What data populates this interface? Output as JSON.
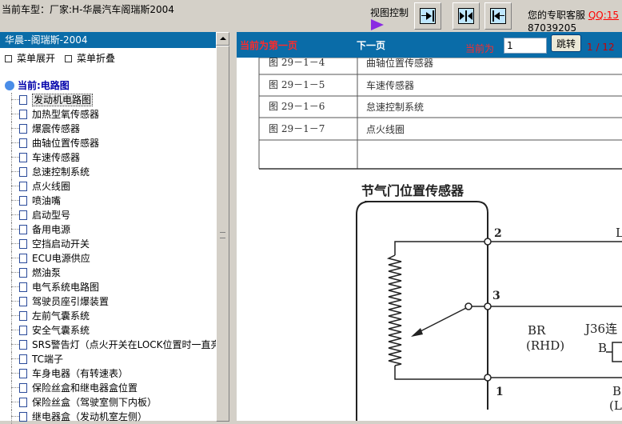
{
  "header": {
    "title": "当前车型：厂家:H-华晨汽车阁瑞斯2004",
    "view_control_label": "视图控制",
    "service_label": "您的专职客服",
    "qq_label": "QQ:15",
    "phone": "87039205"
  },
  "left_panel": {
    "title": "华晨--阁瑞斯-2004",
    "expand_all": "菜单展开",
    "collapse_all": "菜单折叠",
    "root_label": "当前:电路图",
    "items": [
      "发动机电路图",
      "加热型氧传感器",
      "爆震传感器",
      "曲轴位置传感器",
      "车速传感器",
      "怠速控制系统",
      "点火线圈",
      "喷油嘴",
      "启动型号",
      "备用电源",
      "空挡启动开关",
      "ECU电源供应",
      "燃油泵",
      "电气系统电路图",
      "驾驶员座引爆装置",
      "左前气囊系统",
      "安全气囊系统",
      "SRS警告灯（点火开关在LOCK位置时一直亮）",
      "TC端子",
      "车身电器（有转速表）",
      "保险丝盒和继电器盒位置",
      "保险丝盒（驾驶室侧下内板）",
      "继电器盒（发动机室左侧）"
    ],
    "selected_index": 0
  },
  "navigation": {
    "first_page": "当前为第一页",
    "next_page": "下一页",
    "current_label": "当前为",
    "page_value": "1",
    "jump_label": "跳转",
    "page_count": "1 / 12"
  },
  "diagram": {
    "table_rows": [
      {
        "fig": "图 29－1－4",
        "desc": "曲轴位置传感器"
      },
      {
        "fig": "图 29－1－5",
        "desc": "车速传感器"
      },
      {
        "fig": "图 29－1－6",
        "desc": "怠速控制系统"
      },
      {
        "fig": "图 29－1－7",
        "desc": "点火线圈"
      }
    ],
    "sensor_title": "节气门位置传感器",
    "pin_2": "2",
    "pin_3": "3",
    "pin_1": "1",
    "wire_br": "BR",
    "wire_rhd": "(RHD)",
    "connector": "J36连",
    "letter_b_top": "B",
    "letter_b_bottom": "B",
    "letter_l": "(L",
    "letter_l_top": "L"
  }
}
